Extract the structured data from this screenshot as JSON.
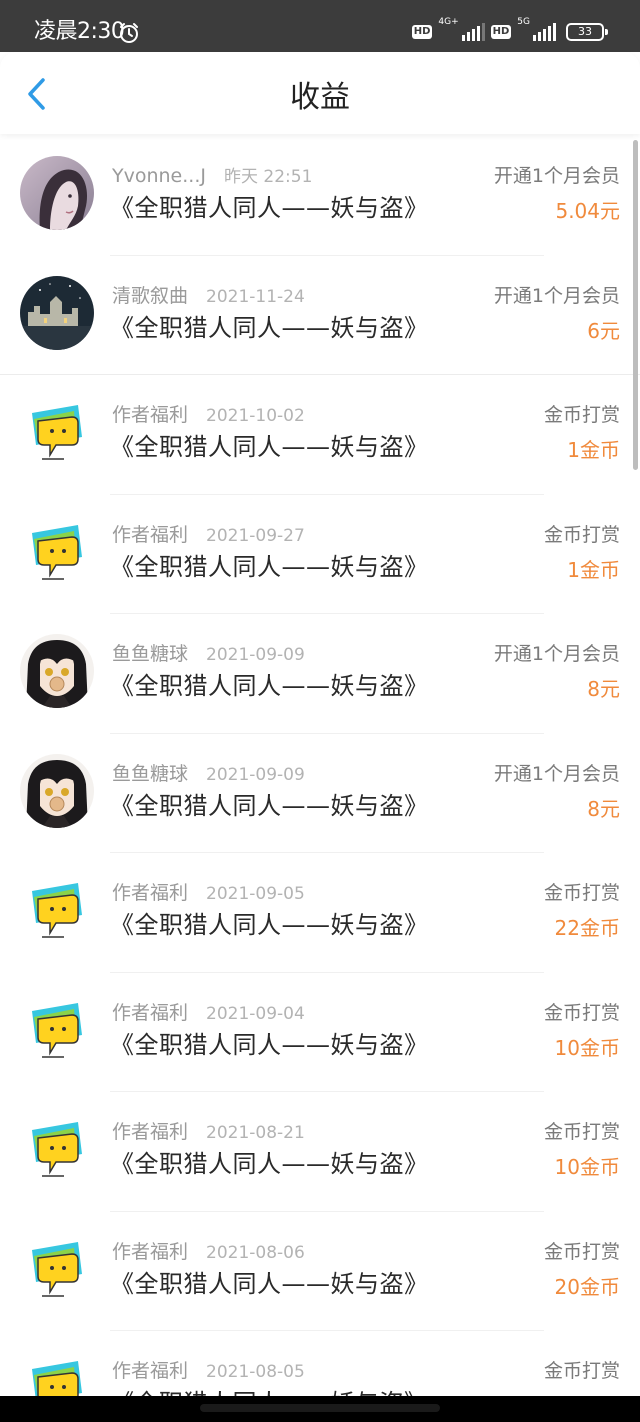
{
  "status_bar": {
    "time": "凌晨2:30",
    "hd1": "HD",
    "net1": "4G+",
    "hd2": "HD",
    "net2": "5G",
    "battery": "33"
  },
  "header": {
    "title": "收益"
  },
  "colors": {
    "accent": "#2f9be6",
    "amount": "#f08a3c"
  },
  "rows": [
    {
      "avatar": "portrait-girl",
      "sender": "Yvonne...J",
      "date": "昨天 22:51",
      "book": "《全职猎人同人——妖与盗》",
      "type": "开通1个月会员",
      "amount": "5.04元"
    },
    {
      "avatar": "castle-night",
      "sender": "清歌叙曲",
      "date": "2021-11-24",
      "book": "《全职猎人同人——妖与盗》",
      "type": "开通1个月会员",
      "amount": "6元"
    },
    {
      "avatar": "author-bonus",
      "sender": "作者福利",
      "date": "2021-10-02",
      "book": "《全职猎人同人——妖与盗》",
      "type": "金币打赏",
      "amount": "1金币"
    },
    {
      "avatar": "author-bonus",
      "sender": "作者福利",
      "date": "2021-09-27",
      "book": "《全职猎人同人——妖与盗》",
      "type": "金币打赏",
      "amount": "1金币"
    },
    {
      "avatar": "anime-girl",
      "sender": "鱼鱼糖球",
      "date": "2021-09-09",
      "book": "《全职猎人同人——妖与盗》",
      "type": "开通1个月会员",
      "amount": "8元"
    },
    {
      "avatar": "anime-girl",
      "sender": "鱼鱼糖球",
      "date": "2021-09-09",
      "book": "《全职猎人同人——妖与盗》",
      "type": "开通1个月会员",
      "amount": "8元"
    },
    {
      "avatar": "author-bonus",
      "sender": "作者福利",
      "date": "2021-09-05",
      "book": "《全职猎人同人——妖与盗》",
      "type": "金币打赏",
      "amount": "22金币"
    },
    {
      "avatar": "author-bonus",
      "sender": "作者福利",
      "date": "2021-09-04",
      "book": "《全职猎人同人——妖与盗》",
      "type": "金币打赏",
      "amount": "10金币"
    },
    {
      "avatar": "author-bonus",
      "sender": "作者福利",
      "date": "2021-08-21",
      "book": "《全职猎人同人——妖与盗》",
      "type": "金币打赏",
      "amount": "10金币"
    },
    {
      "avatar": "author-bonus",
      "sender": "作者福利",
      "date": "2021-08-06",
      "book": "《全职猎人同人——妖与盗》",
      "type": "金币打赏",
      "amount": "20金币"
    },
    {
      "avatar": "author-bonus",
      "sender": "作者福利",
      "date": "2021-08-05",
      "book": "《全职猎人同人——妖与盗》",
      "type": "金币打赏",
      "amount": ""
    }
  ]
}
